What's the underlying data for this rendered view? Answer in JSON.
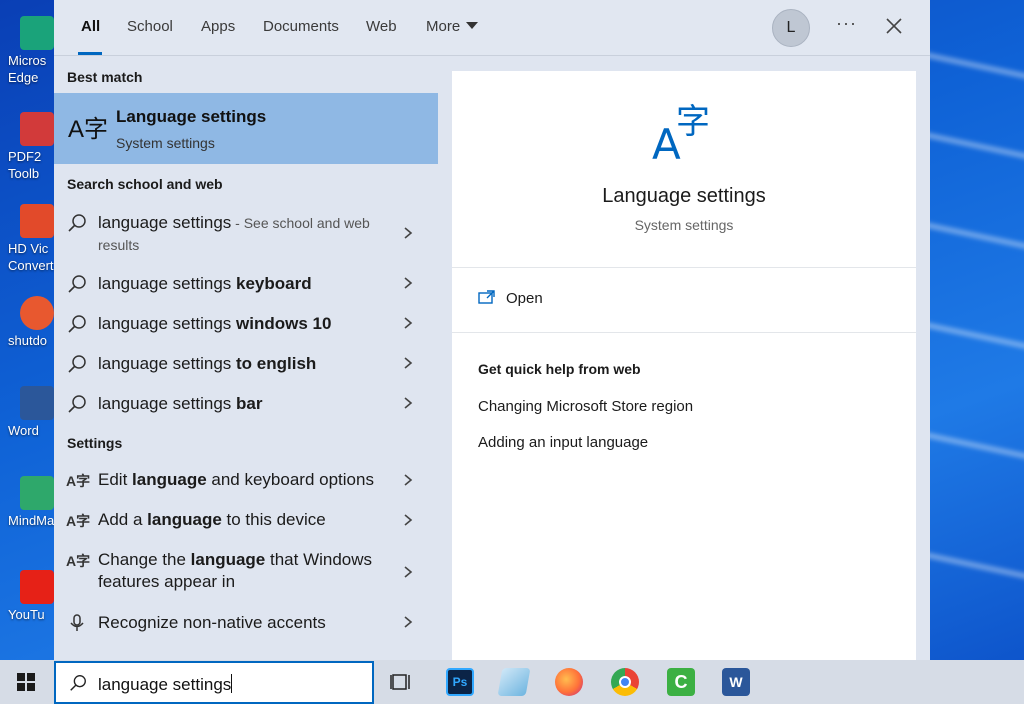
{
  "desktop": {
    "icons": [
      {
        "label": "Micros\nEdge",
        "color": "#1aa37a"
      },
      {
        "label": "PDF2\nToolb",
        "color": "#d23a3a"
      },
      {
        "label": "HD Vic\nConvert",
        "color": "#e24a2a"
      },
      {
        "label": "shutdo",
        "color": "#e8582f"
      },
      {
        "label": "Word",
        "color": "#2b579a"
      },
      {
        "label": "MindMa",
        "color": "#2ea86b"
      },
      {
        "label": "YouTu",
        "color": "#e62117"
      }
    ]
  },
  "search": {
    "tabs": [
      "All",
      "School",
      "Apps",
      "Documents",
      "Web",
      "More"
    ],
    "avatar_letter": "L",
    "more_dots": "···",
    "best_match_header": "Best match",
    "best_match": {
      "icon": "A字",
      "title": "Language settings",
      "subtitle": "System settings"
    },
    "web_header": "Search school and web",
    "web_results": [
      {
        "prefix": "language settings",
        "bold": "",
        "suffix": " - See school and web results"
      },
      {
        "prefix": "language settings ",
        "bold": "keyboard",
        "suffix": ""
      },
      {
        "prefix": "language settings ",
        "bold": "windows 10",
        "suffix": ""
      },
      {
        "prefix": "language settings ",
        "bold": "to english",
        "suffix": ""
      },
      {
        "prefix": "language settings ",
        "bold": "bar",
        "suffix": ""
      }
    ],
    "settings_header": "Settings",
    "settings_results": [
      {
        "pre": "Edit ",
        "bold": "language",
        "post": " and keyboard options"
      },
      {
        "pre": "Add a ",
        "bold": "language",
        "post": " to this device"
      },
      {
        "pre": "Change the ",
        "bold": "language",
        "post": " that Windows features appear in"
      },
      {
        "pre": "Recognize non-native accents",
        "bold": "",
        "post": ""
      }
    ],
    "preview": {
      "icon": "A字",
      "title": "Language settings",
      "subtitle": "System settings",
      "open_label": "Open",
      "quick_help_header": "Get quick help from web",
      "links": [
        "Changing Microsoft Store region",
        "Adding an input language"
      ]
    },
    "query": "language settings"
  },
  "taskbar": {
    "apps": [
      {
        "name": "task-view",
        "color": "#d6dce6"
      },
      {
        "name": "photoshop",
        "color": "#0b2447"
      },
      {
        "name": "notepad",
        "color": "#8ec5e8"
      },
      {
        "name": "firefox",
        "color": "#ff7139"
      },
      {
        "name": "chrome",
        "color": "#34a853"
      },
      {
        "name": "camtasia",
        "color": "#3cb043"
      },
      {
        "name": "word",
        "color": "#2b579a"
      }
    ]
  },
  "colors": {
    "accent": "#0067c0",
    "selected": "#8fb8e4"
  }
}
